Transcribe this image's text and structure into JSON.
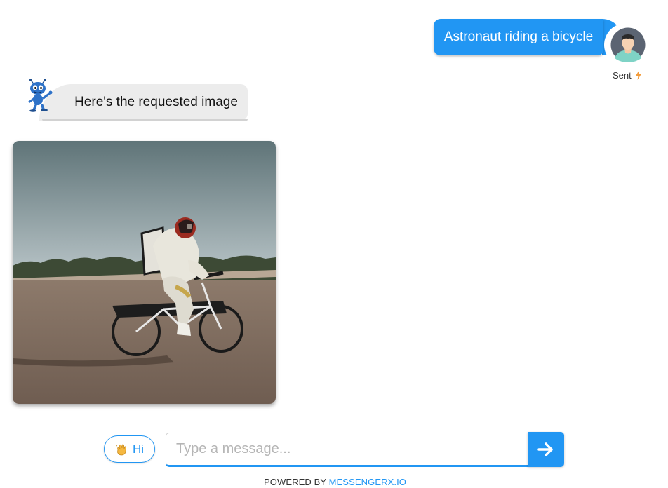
{
  "colors": {
    "accent": "#2196f3",
    "bot_bubble": "#ececec",
    "sent_icon": "#f39c3c"
  },
  "messages": {
    "user": {
      "text": "Astronaut riding a bicycle",
      "status": "Sent",
      "status_icon": "lightning-icon",
      "avatar_icon": "user-avatar-icon"
    },
    "bot": {
      "text": "Here's the requested image",
      "avatar_icon": "alien-bot-icon",
      "image_description_icon": "generated-image"
    }
  },
  "composer": {
    "quick_reply_label": "Hi",
    "quick_reply_icon": "waving-hand-icon",
    "placeholder": "Type a message...",
    "value": "",
    "send_icon": "arrow-right-icon"
  },
  "footer": {
    "prefix": "POWERED BY",
    "brand": "MESSENGERX.IO"
  }
}
